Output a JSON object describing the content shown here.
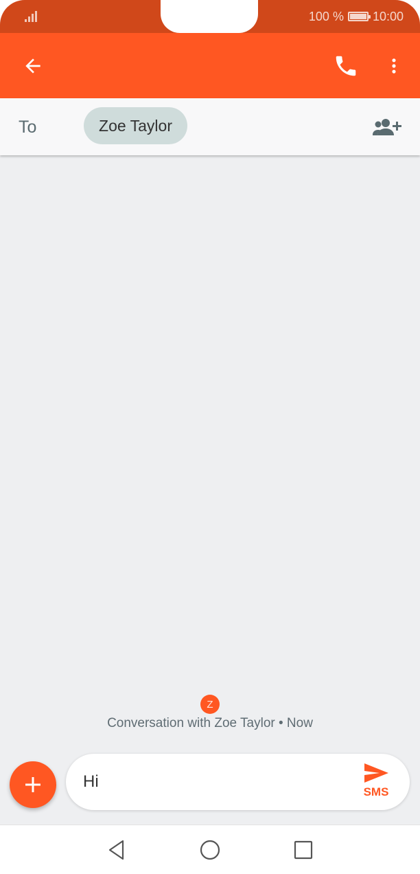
{
  "status_bar": {
    "battery": "100 %",
    "time": "10:00"
  },
  "toolbar": {
    "back": "back-arrow-icon",
    "call": "phone-icon",
    "more": "more-vert-icon"
  },
  "recipient": {
    "to_label": "To",
    "chip": "Zoe Taylor",
    "add": "add-contact-icon"
  },
  "conversation": {
    "avatar_letter": "Z",
    "info": "Conversation with Zoe Taylor • Now"
  },
  "compose": {
    "text": "Hi",
    "send_label": "SMS"
  },
  "colors": {
    "accent": "#ff5722",
    "status": "#d0481a",
    "chip": "#cfdcdb",
    "background": "#eeeff1"
  }
}
